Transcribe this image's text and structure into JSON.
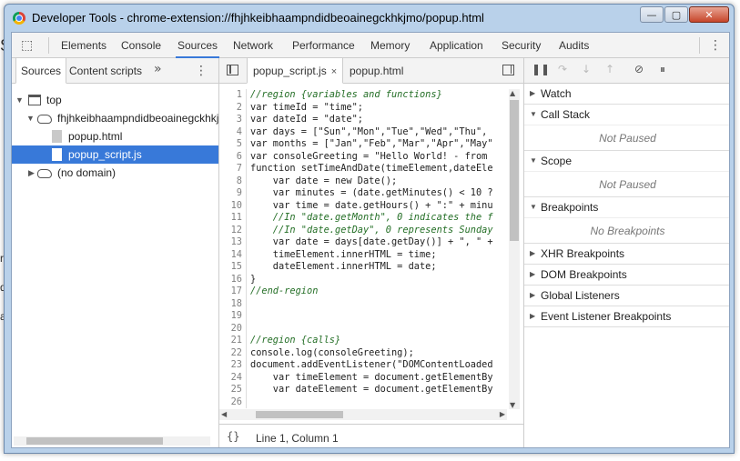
{
  "background_fragments": [
    "S",
    "r",
    "d",
    "a"
  ],
  "window": {
    "title": "Developer Tools - chrome-extension://fhjhkeibhaampndidbeoainegckhkjmo/popup.html",
    "min_label": "—",
    "max_label": "▢",
    "close_label": "✕"
  },
  "main_tabs": [
    {
      "label": "Elements"
    },
    {
      "label": "Console"
    },
    {
      "label": "Sources",
      "active": true
    },
    {
      "label": "Network"
    },
    {
      "label": "Performance"
    },
    {
      "label": "Memory"
    },
    {
      "label": "Application"
    },
    {
      "label": "Security"
    },
    {
      "label": "Audits"
    }
  ],
  "navigator": {
    "tabs": [
      "Sources",
      "Content scripts"
    ],
    "more": "»",
    "tree": [
      {
        "label": "top"
      },
      {
        "label": "fhjhkeibhaampndidbeoainegckhkjmo"
      },
      {
        "label": "popup.html"
      },
      {
        "label": "popup_script.js",
        "selected": true
      },
      {
        "label": "(no domain)"
      }
    ]
  },
  "editor": {
    "tabs": [
      {
        "label": "popup_script.js",
        "active": true,
        "close": "×"
      },
      {
        "label": "popup.html"
      }
    ],
    "lines": [
      {
        "n": "1",
        "text": "//region {variables and functions}",
        "style": "comment"
      },
      {
        "n": "2",
        "text": "var timeId = \"time\";",
        "style": "kw"
      },
      {
        "n": "3",
        "text": "var dateId = \"date\";",
        "style": "kw"
      },
      {
        "n": "4",
        "text": "var days = [\"Sun\",\"Mon\",\"Tue\",\"Wed\",\"Thu\",",
        "style": "kw"
      },
      {
        "n": "5",
        "text": "var months = [\"Jan\",\"Feb\",\"Mar\",\"Apr\",\"May\"",
        "style": "kw"
      },
      {
        "n": "6",
        "text": "var consoleGreeting = \"Hello World! - from",
        "style": "kw"
      },
      {
        "n": "7",
        "text": "function setTimeAndDate(timeElement,dateEle",
        "style": "kw"
      },
      {
        "n": "8",
        "text": "    var date = new Date();",
        "style": "kw"
      },
      {
        "n": "9",
        "text": "    var minutes = (date.getMinutes() < 10 ?",
        "style": "kw"
      },
      {
        "n": "10",
        "text": "    var time = date.getHours() + \":\" + minu",
        "style": "kw"
      },
      {
        "n": "11",
        "text": "    //In \"date.getMonth\", 0 indicates the f",
        "style": "comment"
      },
      {
        "n": "12",
        "text": "    //In \"date.getDay\", 0 represents Sunday",
        "style": "comment"
      },
      {
        "n": "13",
        "text": "    var date = days[date.getDay()] + \", \" +",
        "style": "kw"
      },
      {
        "n": "14",
        "text": "    timeElement.innerHTML = time;",
        "style": "kw"
      },
      {
        "n": "15",
        "text": "    dateElement.innerHTML = date;",
        "style": "kw"
      },
      {
        "n": "16",
        "text": "}",
        "style": "kw"
      },
      {
        "n": "17",
        "text": "//end-region",
        "style": "comment"
      },
      {
        "n": "18",
        "text": "",
        "style": "kw"
      },
      {
        "n": "19",
        "text": "",
        "style": "kw"
      },
      {
        "n": "20",
        "text": "",
        "style": "kw"
      },
      {
        "n": "21",
        "text": "//region {calls}",
        "style": "comment"
      },
      {
        "n": "22",
        "text": "console.log(consoleGreeting);",
        "style": "kw"
      },
      {
        "n": "23",
        "text": "document.addEventListener(\"DOMContentLoaded",
        "style": "kw"
      },
      {
        "n": "24",
        "text": "    var timeElement = document.getElementBy",
        "style": "kw"
      },
      {
        "n": "25",
        "text": "    var dateElement = document.getElementBy",
        "style": "kw"
      },
      {
        "n": "26",
        "text": "",
        "style": "kw"
      }
    ],
    "status_braces": "{}",
    "cursor_position": "Line 1, Column 1"
  },
  "debugger": {
    "sections": [
      {
        "label": "Watch",
        "expanded": false
      },
      {
        "label": "Call Stack",
        "expanded": true,
        "body": "Not Paused"
      },
      {
        "label": "Scope",
        "expanded": true,
        "body": "Not Paused"
      },
      {
        "label": "Breakpoints",
        "expanded": true,
        "body": "No Breakpoints"
      },
      {
        "label": "XHR Breakpoints",
        "expanded": false
      },
      {
        "label": "DOM Breakpoints",
        "expanded": false
      },
      {
        "label": "Global Listeners",
        "expanded": false
      },
      {
        "label": "Event Listener Breakpoints",
        "expanded": false
      }
    ]
  }
}
